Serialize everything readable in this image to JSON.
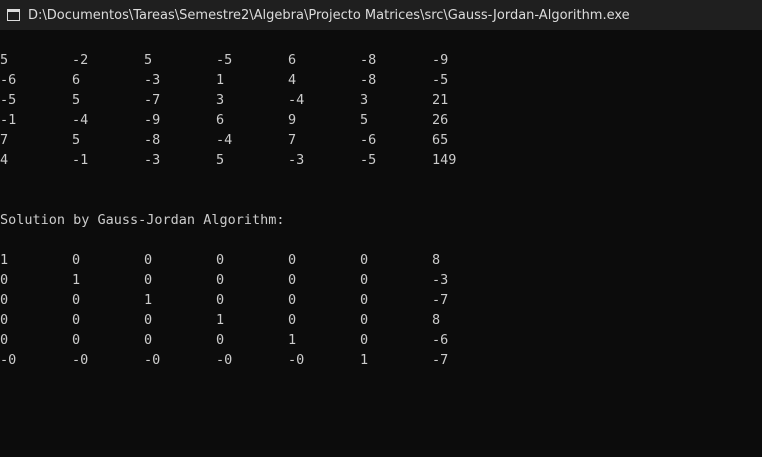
{
  "window": {
    "title": "D:\\Documentos\\Tareas\\Semestre2\\Algebra\\Projecto Matrices\\src\\Gauss-Jordan-Algorithm.exe",
    "icon": "console-window-icon"
  },
  "console": {
    "input_matrix": [
      [
        "5",
        "-2",
        "5",
        "-5",
        "6",
        "-8",
        "-9"
      ],
      [
        "-6",
        "6",
        "-3",
        "1",
        "4",
        "-8",
        "-5"
      ],
      [
        "-5",
        "5",
        "-7",
        "3",
        "-4",
        "3",
        "21"
      ],
      [
        "-1",
        "-4",
        "-9",
        "6",
        "9",
        "5",
        "26"
      ],
      [
        "7",
        "5",
        "-8",
        "-4",
        "7",
        "-6",
        "65"
      ],
      [
        "4",
        "-1",
        "-3",
        "5",
        "-3",
        "-5",
        "149"
      ]
    ],
    "solution_heading": "Solution by Gauss-Jordan Algorithm:",
    "solution_matrix": [
      [
        "1",
        "0",
        "0",
        "0",
        "0",
        "0",
        "8"
      ],
      [
        "0",
        "1",
        "0",
        "0",
        "0",
        "0",
        "-3"
      ],
      [
        "0",
        "0",
        "1",
        "0",
        "0",
        "0",
        "-7"
      ],
      [
        "0",
        "0",
        "0",
        "1",
        "0",
        "0",
        "8"
      ],
      [
        "0",
        "0",
        "0",
        "0",
        "1",
        "0",
        "-6"
      ],
      [
        "-0",
        "-0",
        "-0",
        "-0",
        "-0",
        "1",
        "-7"
      ]
    ]
  },
  "colors": {
    "background": "#0c0c0c",
    "titlebar": "#1f1f1f",
    "text": "#cccccc"
  }
}
